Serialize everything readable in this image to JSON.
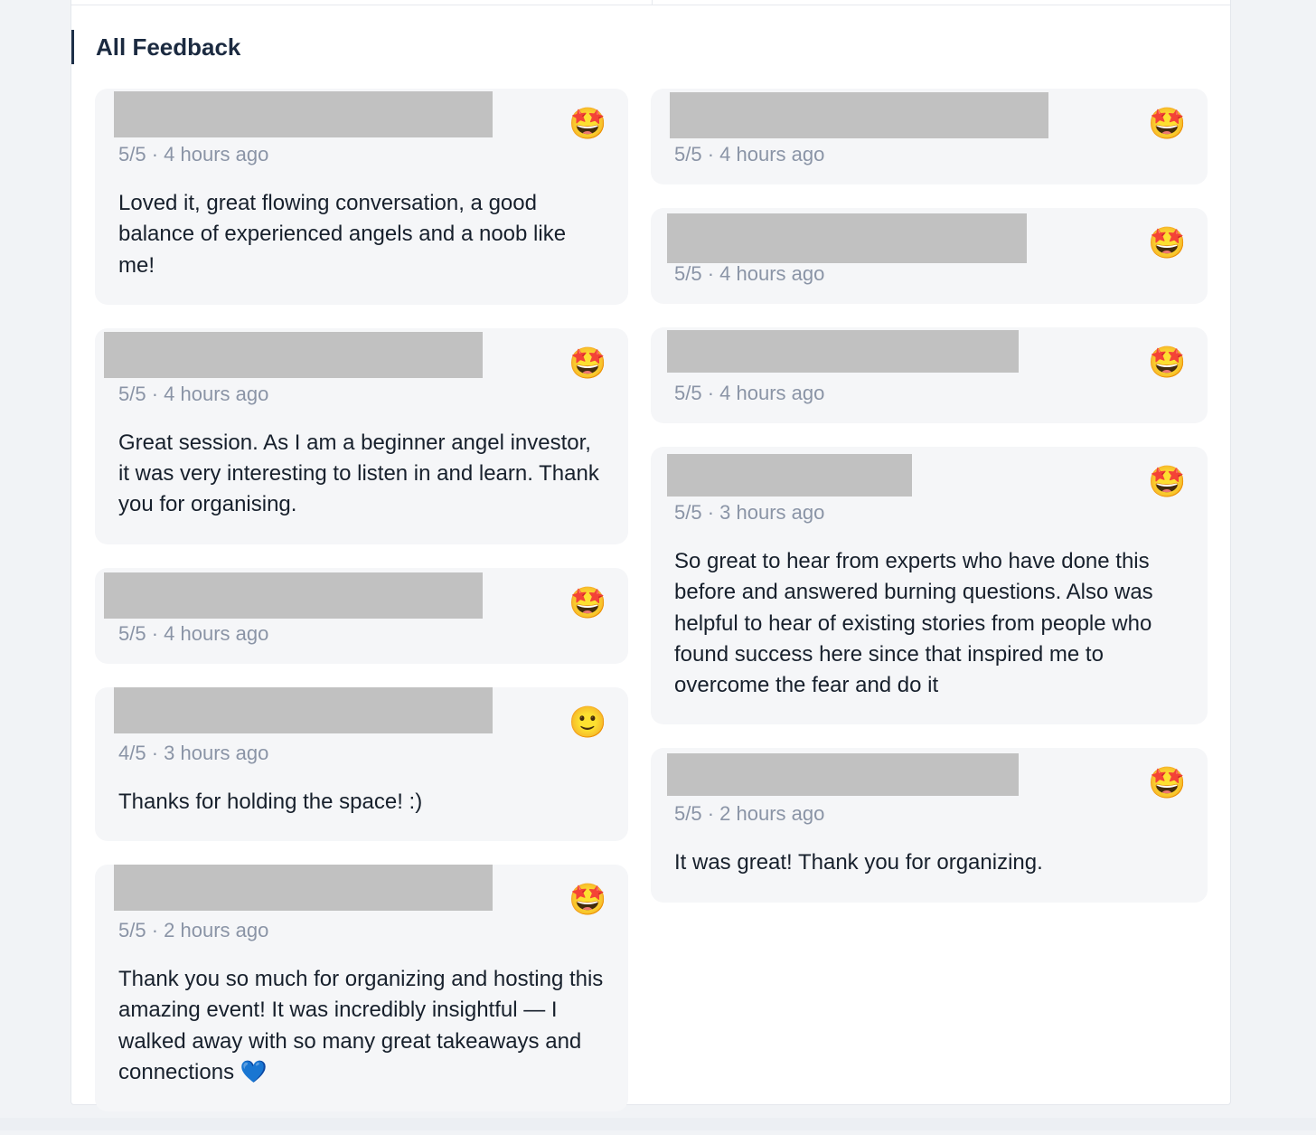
{
  "section": {
    "title": "All Feedback"
  },
  "colors": {
    "card_bg": "#f5f6f8",
    "redaction": "#c1c1c1",
    "meta_text": "#8a94a6",
    "title_accent": "#1e3048"
  },
  "feedback_left": [
    {
      "rating": "5/5",
      "time": "4 hours ago",
      "meta": "5/5 · 4 hours ago",
      "emoji": "🤩",
      "emoji_name": "star-struck-emoji",
      "comment": "Loved it, great flowing conversation, a good balance of experienced angels and a noob like me!"
    },
    {
      "rating": "5/5",
      "time": "4 hours ago",
      "meta": "5/5 · 4 hours ago",
      "emoji": "🤩",
      "emoji_name": "star-struck-emoji",
      "comment": "Great session. As I am a beginner angel investor, it was very interesting to listen in and learn. Thank you for organising."
    },
    {
      "rating": "5/5",
      "time": "4 hours ago",
      "meta": "5/5 · 4 hours ago",
      "emoji": "🤩",
      "emoji_name": "star-struck-emoji",
      "comment": ""
    },
    {
      "rating": "4/5",
      "time": "3 hours ago",
      "meta": "4/5 · 3 hours ago",
      "emoji": "🙂",
      "emoji_name": "slightly-smiling-emoji",
      "comment": "Thanks for holding the space! :)"
    },
    {
      "rating": "5/5",
      "time": "2 hours ago",
      "meta": "5/5 · 2 hours ago",
      "emoji": "🤩",
      "emoji_name": "star-struck-emoji",
      "comment": "Thank you so much for organizing and hosting this amazing event! It was incredibly insightful — I walked away with so many great takeaways and connections 💙"
    }
  ],
  "feedback_right": [
    {
      "rating": "5/5",
      "time": "4 hours ago",
      "meta": "5/5 · 4 hours ago",
      "emoji": "🤩",
      "emoji_name": "star-struck-emoji",
      "comment": ""
    },
    {
      "rating": "5/5",
      "time": "4 hours ago",
      "meta": "5/5 · 4 hours ago",
      "emoji": "🤩",
      "emoji_name": "star-struck-emoji",
      "comment": ""
    },
    {
      "rating": "5/5",
      "time": "4 hours ago",
      "meta": "5/5 · 4 hours ago",
      "emoji": "🤩",
      "emoji_name": "star-struck-emoji",
      "comment": ""
    },
    {
      "rating": "5/5",
      "time": "3 hours ago",
      "meta": "5/5 · 3 hours ago",
      "emoji": "🤩",
      "emoji_name": "star-struck-emoji",
      "comment": "So great to hear from experts who have done this before and answered burning questions. Also was helpful to hear of existing stories from people who found success here since that inspired me to overcome the fear and do it"
    },
    {
      "rating": "5/5",
      "time": "2 hours ago",
      "meta": "5/5 · 2 hours ago",
      "emoji": "🤩",
      "emoji_name": "star-struck-emoji",
      "comment": "It was great! Thank you for organizing."
    }
  ]
}
